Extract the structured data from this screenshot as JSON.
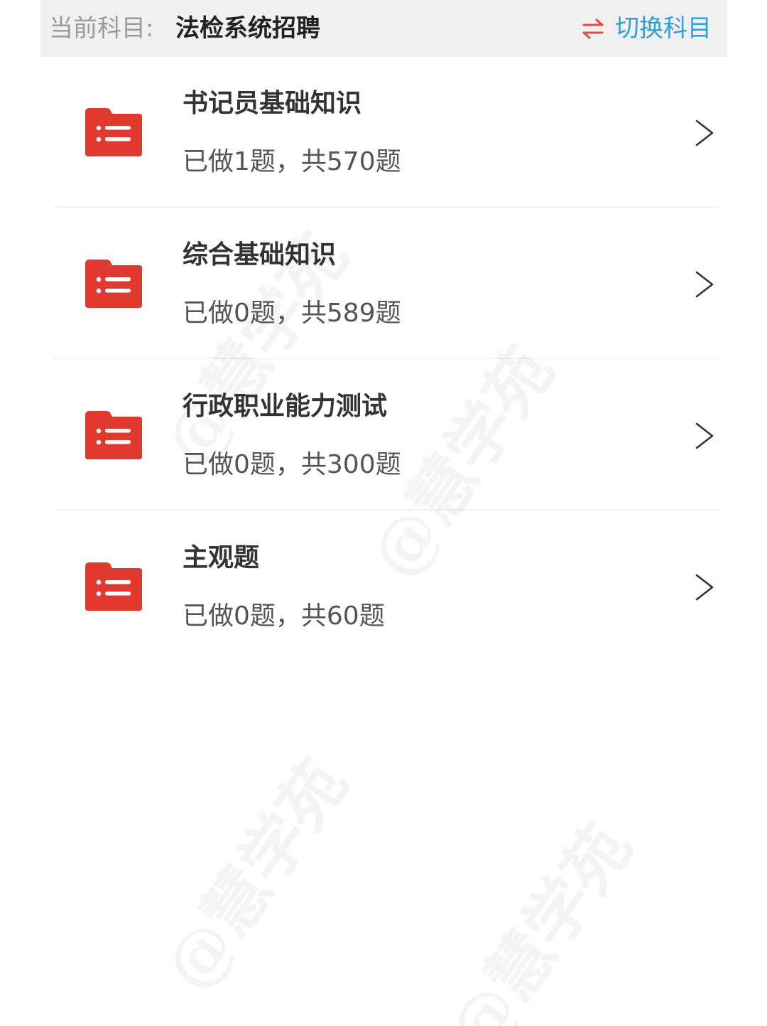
{
  "header": {
    "label": "当前科目:",
    "subject": "法检系统招聘",
    "switch_label": "切换科目",
    "switch_icon": "swap-arrows-icon",
    "switch_icon_color": "#e84a3b",
    "switch_label_color": "#2f9fd6"
  },
  "subjects": [
    {
      "title": "书记员基础知识",
      "progress": "已做1题，共570题",
      "icon": "folder-list-icon"
    },
    {
      "title": "综合基础知识",
      "progress": "已做0题，共589题",
      "icon": "folder-list-icon"
    },
    {
      "title": "行政职业能力测试",
      "progress": "已做0题，共300题",
      "icon": "folder-list-icon"
    },
    {
      "title": "主观题",
      "progress": "已做0题，共60题",
      "icon": "folder-list-icon"
    }
  ],
  "colors": {
    "accent": "#e03a30",
    "header_bg": "#f0f0f0"
  },
  "watermark": "@慧学苑"
}
